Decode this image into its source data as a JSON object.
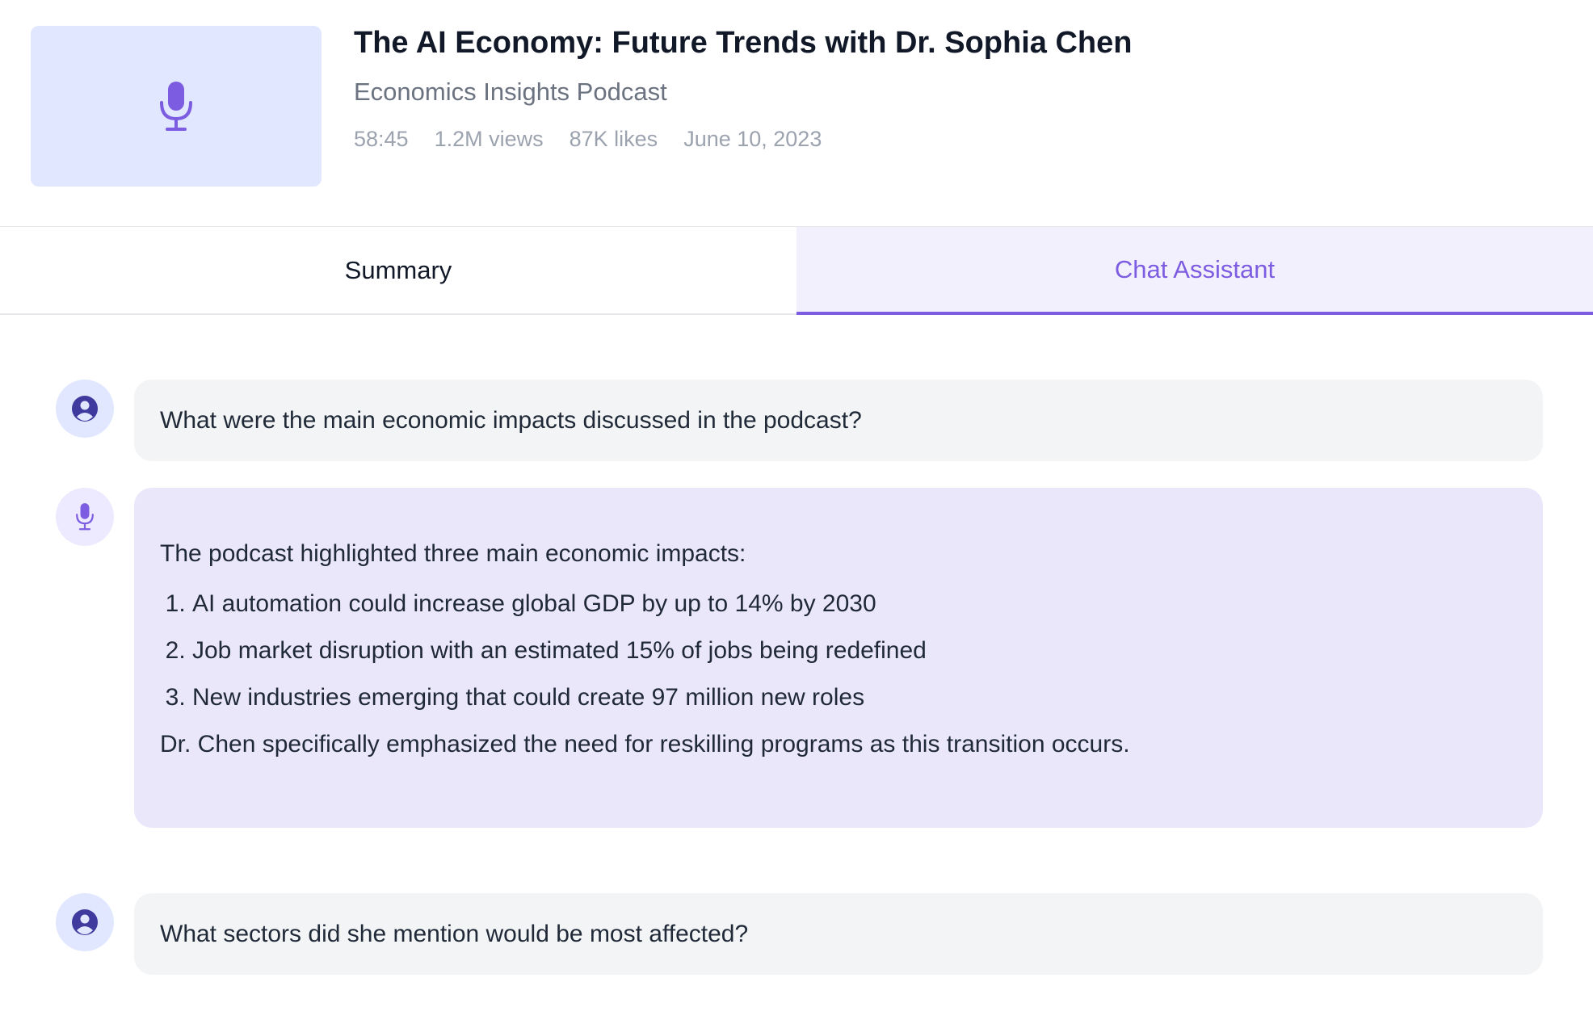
{
  "episode": {
    "title": "The AI Economy: Future Trends with Dr. Sophia Chen",
    "show": "Economics Insights Podcast",
    "duration": "58:45",
    "views": "1.2M views",
    "likes": "87K likes",
    "date": "June 10, 2023",
    "thumbnail_icon": "microphone-icon"
  },
  "tabs": [
    {
      "label": "Summary",
      "active": false
    },
    {
      "label": "Chat Assistant",
      "active": true
    }
  ],
  "chat": {
    "messages": [
      {
        "role": "user",
        "text": "What were the main economic impacts discussed in the podcast?"
      },
      {
        "role": "assistant",
        "intro": "The podcast highlighted three main economic impacts:",
        "points": [
          "AI automation could increase global GDP by up to 14% by 2030",
          "Job market disruption with an estimated 15% of jobs being redefined",
          "New industries emerging that could create 97 million new roles"
        ],
        "outro": "Dr. Chen specifically emphasized the need for reskilling programs as this transition occurs."
      },
      {
        "role": "user",
        "text": "What sectors did she mention would be most affected?"
      }
    ]
  },
  "colors": {
    "accent": "#7c5ce0",
    "thumbnail_bg": "#e0e7ff",
    "user_bubble": "#f3f4f6",
    "assistant_bubble": "#ebe7fb",
    "user_icon": "#3f3a9e"
  }
}
